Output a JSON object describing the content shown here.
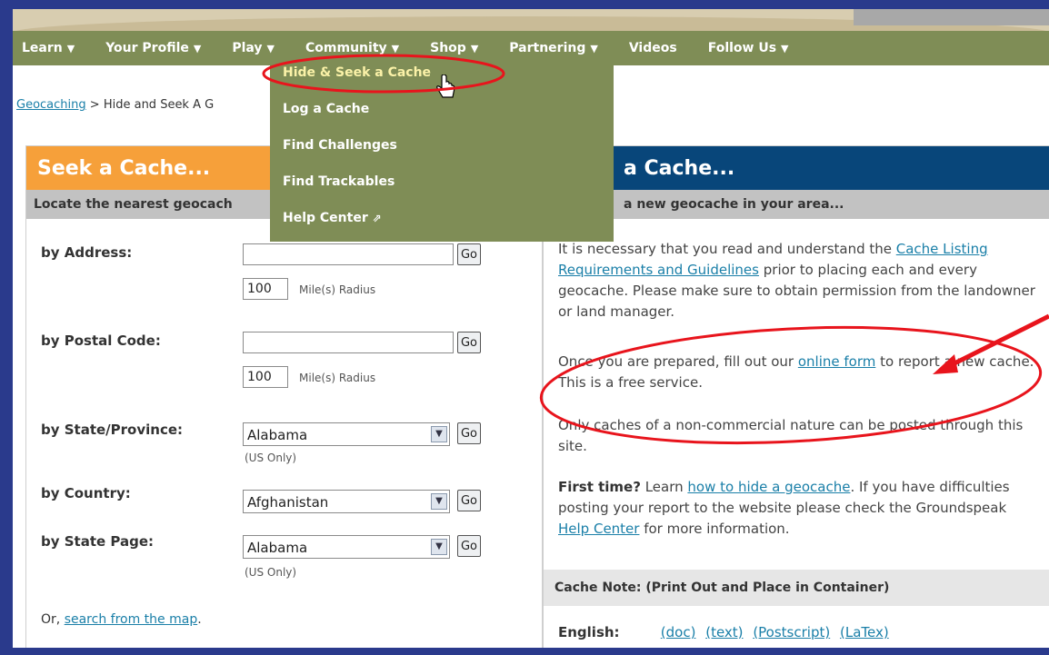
{
  "nav": {
    "items": [
      "Learn",
      "Your Profile",
      "Play",
      "Community",
      "Shop",
      "Partnering",
      "Videos",
      "Follow Us"
    ],
    "carets": [
      true,
      true,
      true,
      true,
      true,
      true,
      false,
      true
    ],
    "caret_glyph": "▼"
  },
  "play_menu": {
    "items": [
      "Hide & Seek a Cache",
      "Log a Cache",
      "Find Challenges",
      "Find Trackables",
      "Help Center"
    ],
    "active_index": 0,
    "external_glyph": "⇗"
  },
  "breadcrumb": {
    "root": "Geocaching",
    "separator": ">",
    "current": "Hide and Seek A G"
  },
  "seek": {
    "title": "Seek a Cache...",
    "subtitle": "Locate the nearest geocach",
    "by_address_label": "by Address:",
    "by_postal_label": "by Postal Code:",
    "radius_value": "100",
    "radius_label": "Mile(s) Radius",
    "go_label": "Go",
    "by_state_label": "by State/Province:",
    "state_selected": "Alabama",
    "us_only": "(US Only)",
    "by_country_label": "by Country:",
    "country_selected": "Afghanistan",
    "by_state_page_label": "by State Page:",
    "state_page_selected": "Alabama",
    "or_prefix": "Or, ",
    "map_link": "search from the map",
    "or_suffix": "."
  },
  "hide": {
    "title": "a Cache...",
    "subtitle": "a new geocache in your area...",
    "p1_a": "It is necessary that you read and understand the ",
    "p1_link": "Cache Listing Requirements and Guidelines",
    "p1_b": " prior to placing each and every geocache. Please make sure to obtain permission from the landowner or land manager.",
    "p2_a": "Once you are prepared, fill out our ",
    "p2_link": "online form",
    "p2_b": " to report a new cache. This is a free service.",
    "p3": "Only caches of a non-commercial nature can be posted through this site.",
    "p4_bold": "First time?",
    "p4_a": " Learn ",
    "p4_link": "how to hide a geocache",
    "p4_b": ". If you have difficulties posting your report to the website please check the Groundspeak ",
    "p4_link2": "Help Center",
    "p4_c": " for more information.",
    "note_bar": "Cache Note: (Print Out and Place in Container)",
    "english_label": "English:",
    "formats": [
      "(doc)",
      "(text)",
      "(Postscript)",
      "(LaTex)"
    ]
  },
  "annotation_color": "#e8141c"
}
